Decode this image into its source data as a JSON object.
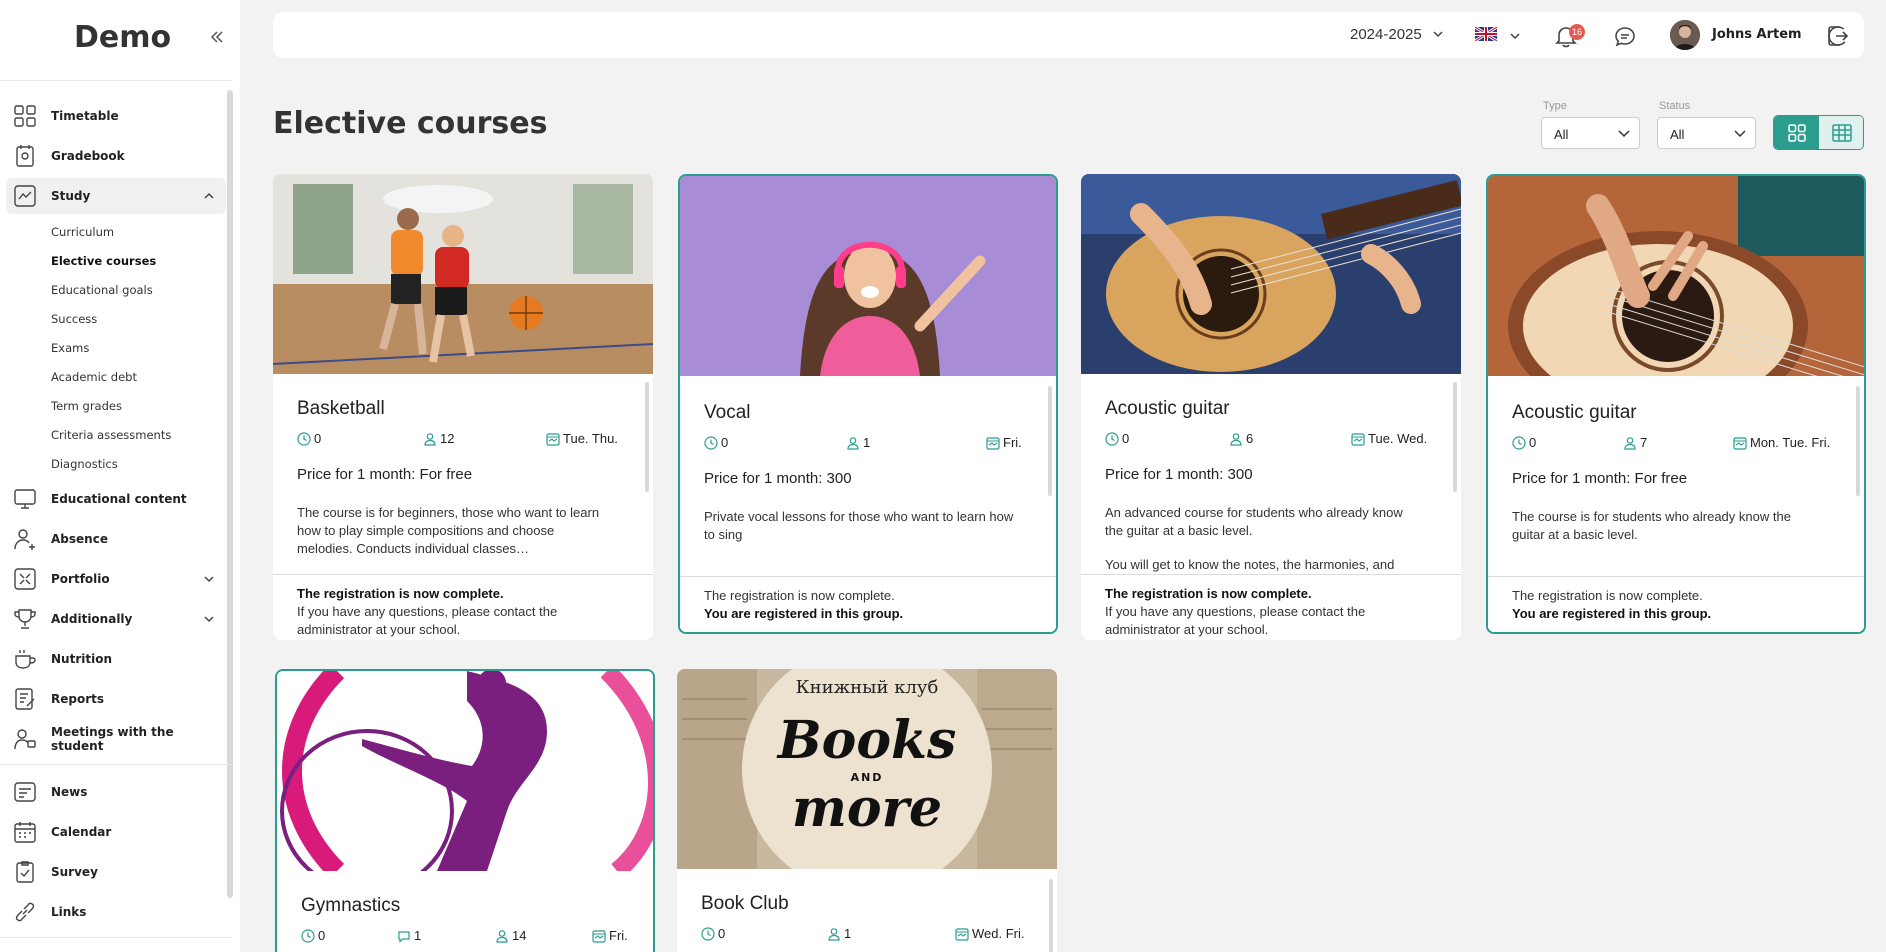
{
  "app": {
    "logo": "Demo"
  },
  "sidebar": {
    "items": [
      {
        "label": "Timetable",
        "icon": "grid-icon"
      },
      {
        "label": "Gradebook",
        "icon": "notebook-icon"
      },
      {
        "label": "Study",
        "icon": "chart-icon",
        "expanded": true
      },
      {
        "label": "Educational content",
        "icon": "monitor-icon"
      },
      {
        "label": "Absence",
        "icon": "person-icon"
      },
      {
        "label": "Portfolio",
        "icon": "portfolio-icon"
      },
      {
        "label": "Additionally",
        "icon": "trophy-icon"
      },
      {
        "label": "Nutrition",
        "icon": "cup-icon"
      },
      {
        "label": "Reports",
        "icon": "report-icon"
      },
      {
        "label": "Meetings with the student",
        "icon": "meeting-icon"
      },
      {
        "label": "News",
        "icon": "news-icon"
      },
      {
        "label": "Calendar",
        "icon": "calendar-icon"
      },
      {
        "label": "Survey",
        "icon": "survey-icon"
      },
      {
        "label": "Links",
        "icon": "link-icon"
      }
    ],
    "study_sub": [
      "Curriculum",
      "Elective courses",
      "Educational goals",
      "Success",
      "Exams",
      "Academic debt",
      "Term grades",
      "Criteria assessments",
      "Diagnostics"
    ]
  },
  "topbar": {
    "year": "2024-2025",
    "notifications_count": "16",
    "user_name": "Johns Artem"
  },
  "page": {
    "title": "Elective courses",
    "filters": {
      "type_label": "Type",
      "type_value": "All",
      "status_label": "Status",
      "status_value": "All"
    }
  },
  "courses": [
    {
      "title": "Basketball",
      "hours": "0",
      "students": "12",
      "days": "Tue. Thu.",
      "price": "Price for 1 month: For free",
      "desc": "The course is for beginners, those who want to learn how to play simple compositions and choose melodies. Conducts individual classes…",
      "foot_bold": "The registration is now complete.",
      "foot_text": "If you have any questions, please contact the administrator at your school."
    },
    {
      "title": "Vocal",
      "hours": "0",
      "students": "1",
      "days": "Fri.",
      "price": "Price for 1 month: 300",
      "desc": "Private vocal lessons for those who want to learn how to sing",
      "foot_text": "The registration is now complete.",
      "foot_bold": "You are registered in this group."
    },
    {
      "title": "Acoustic guitar",
      "hours": "0",
      "students": "6",
      "days": "Tue. Wed.",
      "price": "Price for 1 month: 300",
      "desc": "An advanced course for students who already know the guitar at a basic level.",
      "desc2": "You will get to know the notes, the harmonies, and",
      "foot_bold": "The registration is now complete.",
      "foot_text": "If you have any questions, please contact the administrator at your school."
    },
    {
      "title": "Acoustic guitar",
      "hours": "0",
      "students": "7",
      "days": "Mon. Tue. Fri.",
      "price": "Price for 1 month: For free",
      "desc": "The course is for students who already know the guitar at a basic level.",
      "foot_text": "The registration is now complete.",
      "foot_bold": "You are registered in this group."
    },
    {
      "title": "Gymnastics",
      "hours": "0",
      "comments": "1",
      "students": "14",
      "days": "Fri."
    },
    {
      "title": "Book Club",
      "hours": "0",
      "students": "1",
      "days": "Wed. Fri.",
      "image_caption": "Книжный клуб",
      "image_logo_top": "Books",
      "image_logo_mid": "AND",
      "image_logo_bottom": "more"
    }
  ],
  "colors": {
    "accent": "#2a9d8f",
    "badge": "#e45b4f"
  }
}
